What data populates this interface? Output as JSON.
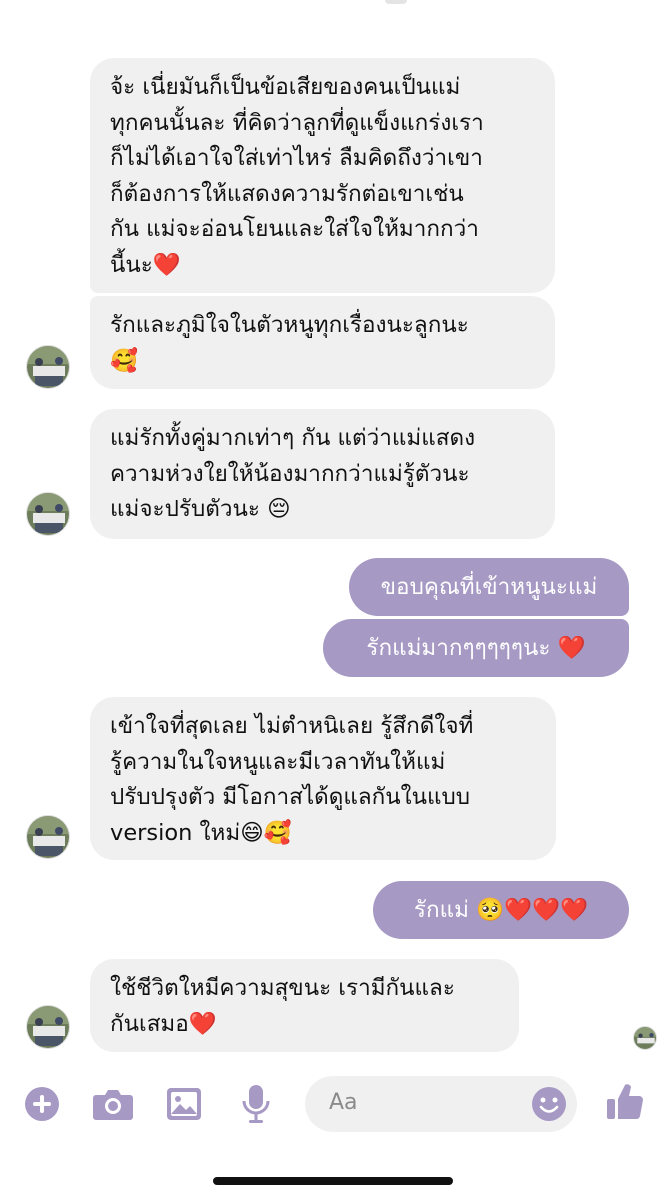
{
  "colors": {
    "accent": "#a699c4",
    "incoming_bg": "#f0f0f0",
    "outgoing_text": "#ffffff"
  },
  "messages": [
    {
      "side": "incoming",
      "text": "จ้ะ เนี่ยมันก็เป็นข้อเสียของคนเป็นแม่\nทุกคนนั้นละ ที่คิดว่าลูกที่ดูแข็งแกร่งเรา\nก็ไม่ได้เอาใจใส่เท่าไหร่ ลืมคิดถึงว่าเขา\nก็ต้องการให้แสดงความรักต่อเขาเช่น\nกัน แม่จะอ่อนโยนและใส่ใจให้มากกว่า\nนี้นะ❤️"
    },
    {
      "side": "incoming",
      "text": "รักและภูมิใจในตัวหนูทุกเรื่องนะลูกนะ\n🥰"
    },
    {
      "side": "incoming",
      "text": "แม่รักทั้งคู่มากเท่าๆ กัน แต่ว่าแม่แสดง\nความห่วงใยให้น้องมากกว่าแม่รู้ตัวนะ\nแม่จะปรับตัวนะ 😔"
    },
    {
      "side": "outgoing",
      "text": "ขอบคุณที่เข้าหนูนะแม่"
    },
    {
      "side": "outgoing",
      "text": "รักแม่มากๆๆๆๆๆนะ ❤️"
    },
    {
      "side": "incoming",
      "text": "เข้าใจที่สุดเลย ไม่ตำหนิเลย รู้สึกดีใจที่\nรู้ความในใจหนูและมีเวลาทันให้แม่\nปรับปรุงตัว มีโอกาสได้ดูแลกันในแบบ\nversion ใหม่😄🥰"
    },
    {
      "side": "outgoing",
      "text": "รักแม่ 🥺❤️❤️❤️"
    },
    {
      "side": "incoming",
      "text": "ใช้ชีวิตใหมีความสุขนะ เรามีกันและ\nกันเสมอ❤️"
    }
  ],
  "composer": {
    "placeholder": "Aa",
    "icons": [
      "plus-icon",
      "camera-icon",
      "gallery-icon",
      "microphone-icon",
      "emoji-icon",
      "thumbs-up-icon"
    ]
  }
}
